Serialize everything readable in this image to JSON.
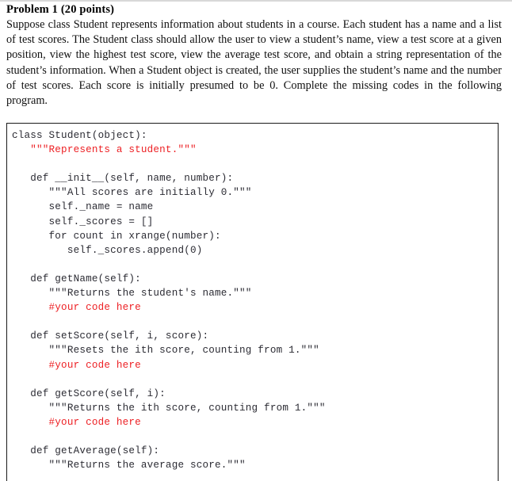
{
  "document": {
    "problem": {
      "title": "Problem 1 (20 points)",
      "body": "Suppose class Student represents information about students in a course. Each student has a name and a list of test scores. The Student class should allow the user to view a student’s name, view a test score at a given position, view the highest test score, view the average test score, and obtain a string representation of the student’s information. When a Student object is created, the user supplies the student’s name and the number of test scores. Each score is initially presumed to be 0. Complete the missing codes in the following program."
    },
    "code_block": {
      "language": "python",
      "default_color": "#2b2b33",
      "highlight_color": "#ed2024",
      "border_color": "#1a1a1a",
      "lines": [
        {
          "text": "class Student(object):",
          "color": "default"
        },
        {
          "text": "   \"\"\"Represents a student.\"\"\"",
          "color": "highlight"
        },
        {
          "text": "",
          "color": "default"
        },
        {
          "text": "   def __init__(self, name, number):",
          "color": "default"
        },
        {
          "text": "      \"\"\"All scores are initially 0.\"\"\"",
          "color": "default"
        },
        {
          "text": "      self._name = name",
          "color": "default"
        },
        {
          "text": "      self._scores = []",
          "color": "default"
        },
        {
          "text": "      for count in xrange(number):",
          "color": "default"
        },
        {
          "text": "         self._scores.append(0)",
          "color": "default"
        },
        {
          "text": "",
          "color": "default"
        },
        {
          "text": "   def getName(self):",
          "color": "default"
        },
        {
          "text": "      \"\"\"Returns the student's name.\"\"\"",
          "color": "default"
        },
        {
          "text": "      #your code here",
          "color": "highlight"
        },
        {
          "text": "",
          "color": "default"
        },
        {
          "text": "   def setScore(self, i, score):",
          "color": "default"
        },
        {
          "text": "      \"\"\"Resets the ith score, counting from 1.\"\"\"",
          "color": "default"
        },
        {
          "text": "      #your code here",
          "color": "highlight"
        },
        {
          "text": "",
          "color": "default"
        },
        {
          "text": "   def getScore(self, i):",
          "color": "default"
        },
        {
          "text": "      \"\"\"Returns the ith score, counting from 1.\"\"\"",
          "color": "default"
        },
        {
          "text": "      #your code here",
          "color": "highlight"
        },
        {
          "text": "",
          "color": "default"
        },
        {
          "text": "   def getAverage(self):",
          "color": "default"
        },
        {
          "text": "      \"\"\"Returns the average score.\"\"\"",
          "color": "default"
        }
      ]
    }
  }
}
